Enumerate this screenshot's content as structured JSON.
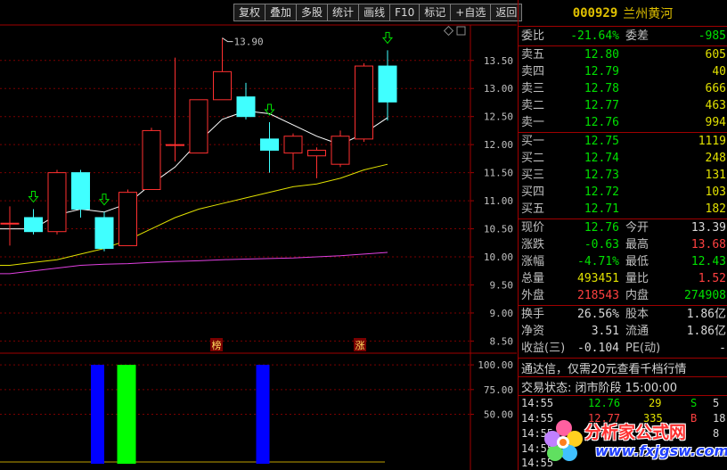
{
  "toolbar": [
    "复权",
    "叠加",
    "多股",
    "统计",
    "画线",
    "F10",
    "标记",
    "+自选",
    "返回"
  ],
  "chart": {
    "price_ticks": [
      "13.50",
      "13.00",
      "12.50",
      "12.00",
      "11.50",
      "11.00",
      "10.50",
      "10.00",
      "9.50",
      "9.00",
      "8.50"
    ],
    "high_annotation": "13.90",
    "badge_left": "榜",
    "badge_right": "涨",
    "vol_ticks": [
      "100.00",
      "75.00",
      "50.00"
    ],
    "colors": {
      "up": "#ff3030",
      "down": "#40ffff",
      "ma_white": "#ffffff",
      "ma_yellow": "#e0e000",
      "ma_magenta": "#e040e0"
    }
  },
  "chart_data": {
    "type": "candlestick",
    "ylim": [
      8.3,
      14.1
    ],
    "candles": [
      {
        "o": 10.6,
        "c": 10.6,
        "h": 10.9,
        "l": 10.2,
        "dir": "up"
      },
      {
        "o": 10.7,
        "c": 10.45,
        "h": 10.85,
        "l": 10.4,
        "dir": "down"
      },
      {
        "o": 10.45,
        "c": 11.5,
        "h": 11.55,
        "l": 10.4,
        "dir": "up"
      },
      {
        "o": 11.5,
        "c": 10.85,
        "h": 11.55,
        "l": 10.7,
        "dir": "down"
      },
      {
        "o": 10.7,
        "c": 10.15,
        "h": 10.8,
        "l": 10.1,
        "dir": "down"
      },
      {
        "o": 10.2,
        "c": 11.15,
        "h": 11.2,
        "l": 10.2,
        "dir": "up"
      },
      {
        "o": 11.2,
        "c": 12.25,
        "h": 12.3,
        "l": 11.2,
        "dir": "up"
      },
      {
        "o": 12.0,
        "c": 12.0,
        "h": 13.55,
        "l": 11.7,
        "dir": "up"
      },
      {
        "o": 11.85,
        "c": 12.8,
        "h": 12.8,
        "l": 11.85,
        "dir": "up"
      },
      {
        "o": 12.8,
        "c": 13.3,
        "h": 13.9,
        "l": 12.8,
        "dir": "up"
      },
      {
        "o": 12.85,
        "c": 12.5,
        "h": 13.1,
        "l": 12.45,
        "dir": "down"
      },
      {
        "o": 12.1,
        "c": 11.9,
        "h": 12.4,
        "l": 11.5,
        "dir": "down"
      },
      {
        "o": 11.85,
        "c": 12.15,
        "h": 12.2,
        "l": 11.55,
        "dir": "up"
      },
      {
        "o": 11.8,
        "c": 11.9,
        "h": 11.95,
        "l": 11.4,
        "dir": "up"
      },
      {
        "o": 11.65,
        "c": 12.15,
        "h": 12.25,
        "l": 11.6,
        "dir": "up"
      },
      {
        "o": 12.1,
        "c": 13.4,
        "h": 13.45,
        "l": 12.05,
        "dir": "up"
      },
      {
        "o": 13.4,
        "c": 12.76,
        "h": 13.68,
        "l": 12.43,
        "dir": "down"
      }
    ],
    "ma_white": [
      10.5,
      10.5,
      10.75,
      10.85,
      10.8,
      10.95,
      11.3,
      11.6,
      12.05,
      12.45,
      12.6,
      12.55,
      12.35,
      12.15,
      12.0,
      12.2,
      12.48
    ],
    "ma_yellow": [
      9.85,
      9.9,
      9.95,
      10.05,
      10.15,
      10.3,
      10.5,
      10.7,
      10.85,
      10.95,
      11.05,
      11.15,
      11.25,
      11.3,
      11.4,
      11.55,
      11.65
    ],
    "ma_magenta": [
      9.7,
      9.75,
      9.8,
      9.85,
      9.87,
      9.88,
      9.9,
      9.92,
      9.93,
      9.95,
      9.96,
      9.97,
      9.98,
      10.0,
      10.02,
      10.05,
      10.08
    ],
    "signal_arrows": [
      1,
      4,
      11,
      16
    ],
    "volume_bars": [
      {
        "index": 4,
        "value": 100,
        "color": "#0000ff"
      },
      {
        "index": 5,
        "value": 100,
        "color": "#00ff00"
      },
      {
        "index": 11,
        "value": 100,
        "color": "#0000ff"
      }
    ],
    "volume_ylim": [
      0,
      110
    ]
  },
  "quote": {
    "code": "000929",
    "name": "兰州黄河",
    "weibi_label": "委比",
    "weibi": "-21.64%",
    "weicha_label": "委差",
    "weicha": "-985",
    "sells": [
      {
        "label": "卖五",
        "price": "12.80",
        "vol": "605"
      },
      {
        "label": "卖四",
        "price": "12.79",
        "vol": "40"
      },
      {
        "label": "卖三",
        "price": "12.78",
        "vol": "666"
      },
      {
        "label": "卖二",
        "price": "12.77",
        "vol": "463"
      },
      {
        "label": "卖一",
        "price": "12.76",
        "vol": "994"
      }
    ],
    "buys": [
      {
        "label": "买一",
        "price": "12.75",
        "vol": "1119"
      },
      {
        "label": "买二",
        "price": "12.74",
        "vol": "248"
      },
      {
        "label": "买三",
        "price": "12.73",
        "vol": "131"
      },
      {
        "label": "买四",
        "price": "12.72",
        "vol": "103"
      },
      {
        "label": "买五",
        "price": "12.71",
        "vol": "182"
      }
    ],
    "stats": [
      {
        "l1": "现价",
        "v1": "12.76",
        "c1": "g",
        "l2": "今开",
        "v2": "13.39",
        "c2": "w"
      },
      {
        "l1": "涨跌",
        "v1": "-0.63",
        "c1": "g",
        "l2": "最高",
        "v2": "13.68",
        "c2": "r"
      },
      {
        "l1": "涨幅",
        "v1": "-4.71%",
        "c1": "g",
        "l2": "最低",
        "v2": "12.43",
        "c2": "g"
      },
      {
        "l1": "总量",
        "v1": "493451",
        "c1": "y",
        "l2": "量比",
        "v2": "1.52",
        "c2": "r"
      },
      {
        "l1": "外盘",
        "v1": "218543",
        "c1": "r",
        "l2": "内盘",
        "v2": "274908",
        "c2": "g"
      }
    ],
    "extra": [
      {
        "l1": "换手",
        "v1": "26.56%",
        "l2": "股本",
        "v2": "1.86亿"
      },
      {
        "l1": "净资",
        "v1": "3.51",
        "l2": "流通",
        "v2": "1.86亿"
      },
      {
        "l1": "收益(三)",
        "v1": "-0.104",
        "l2": "PE(动)",
        "v2": "-"
      }
    ],
    "notice": "通达信，仅需20元查看千档行情",
    "trade_status": "交易状态: 闭市阶段 15:00:00",
    "ticks": [
      {
        "time": "14:55",
        "price": "12.76",
        "vol": "29",
        "bs": "S",
        "num": "5"
      },
      {
        "time": "14:55",
        "price": "12.77",
        "vol": "335",
        "bs": "B",
        "num": "18"
      },
      {
        "time": "14:55",
        "price": "",
        "vol": "",
        "bs": "",
        "num": "8"
      },
      {
        "time": "14:55",
        "price": "",
        "vol": "",
        "bs": "",
        "num": ""
      },
      {
        "time": "14:55",
        "price": "",
        "vol": "",
        "bs": "",
        "num": ""
      }
    ]
  },
  "watermark": {
    "title": "分析家公式网",
    "url": "www.fxjgsw.com"
  }
}
